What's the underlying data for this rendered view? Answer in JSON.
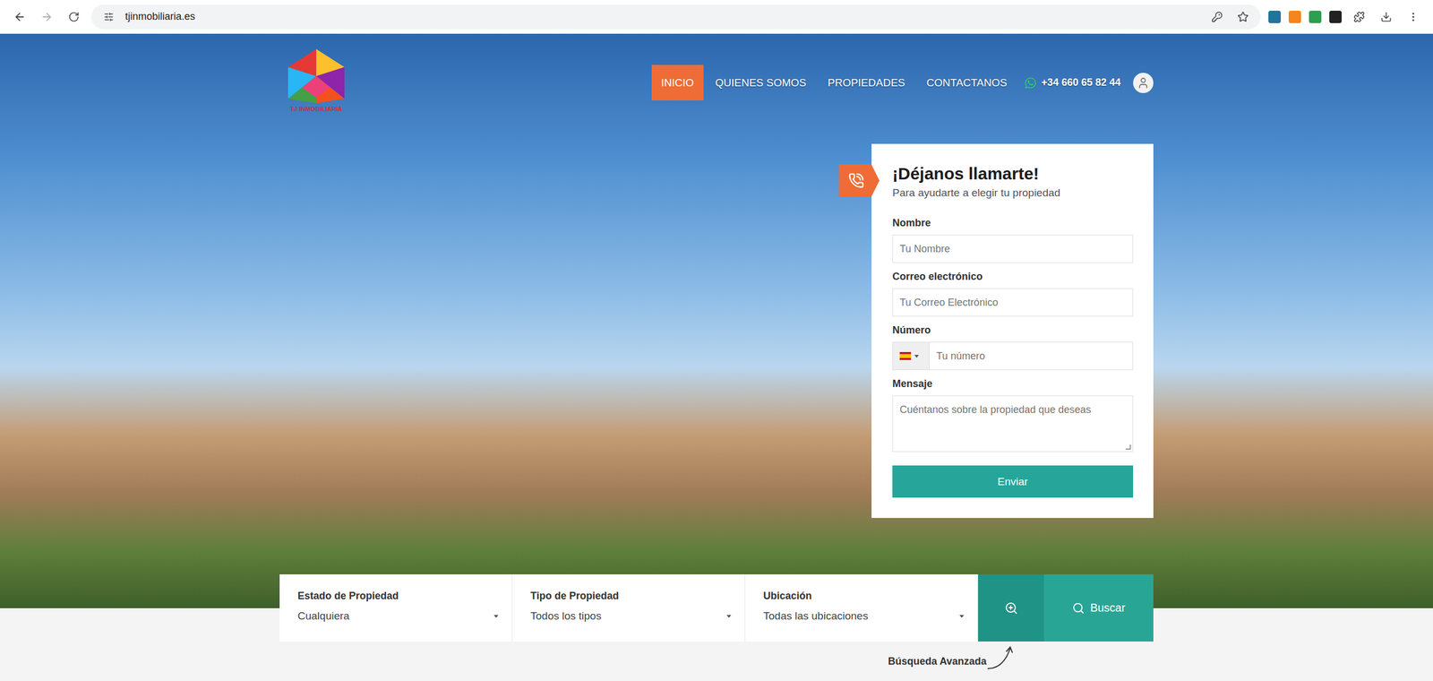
{
  "browser": {
    "url": "tjinmobiliaria.es"
  },
  "logo": {
    "text": "TJ INMOBILIARIA"
  },
  "nav": [
    {
      "label": "INICIO",
      "selected": true
    },
    {
      "label": "QUIENES SOMOS",
      "selected": false
    },
    {
      "label": "PROPIEDADES",
      "selected": false
    },
    {
      "label": "CONTACTANOS",
      "selected": false
    }
  ],
  "phone": "+34 660 65 82 44",
  "form": {
    "title": "¡Déjanos llamarte!",
    "subtitle": "Para ayudarte a elegir tu propiedad",
    "fields": [
      {
        "label": "Nombre",
        "placeholder": "Tu Nombre",
        "kind": "text"
      },
      {
        "label": "Correo electrónico",
        "placeholder": "Tu Correo Electrónico",
        "kind": "text"
      },
      {
        "label": "Número",
        "placeholder": "Tu número",
        "kind": "phone"
      },
      {
        "label": "Mensaje",
        "placeholder": "Cuéntanos sobre la propiedad que deseas",
        "kind": "textarea"
      }
    ],
    "submit": "Enviar"
  },
  "search": {
    "filters": [
      {
        "label": "Estado de Propiedad",
        "value": "Cualquiera"
      },
      {
        "label": "Tipo de Propiedad",
        "value": "Todos los tipos"
      },
      {
        "label": "Ubicación",
        "value": "Todas las ubicaciones"
      }
    ],
    "button": "Buscar",
    "advanced": "Búsqueda Avanzada"
  }
}
